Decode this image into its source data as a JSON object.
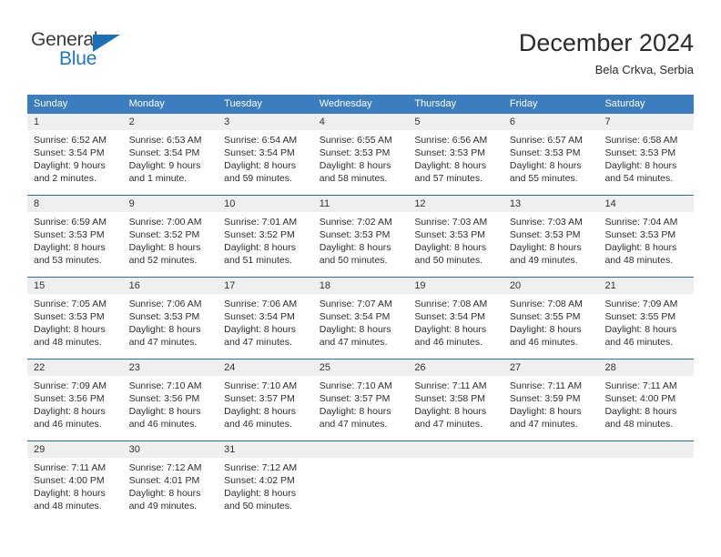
{
  "brand": {
    "name_part1": "General",
    "name_part2": "Blue",
    "triangle_icon": "triangle-icon",
    "accent_color": "#1b6fb5"
  },
  "header": {
    "title": "December 2024",
    "subtitle": "Bela Crkva, Serbia"
  },
  "calendar": {
    "header_bg": "#3b7dbf",
    "daynum_bg": "#efefef",
    "row_border": "#2e6da4",
    "weekdays": [
      "Sunday",
      "Monday",
      "Tuesday",
      "Wednesday",
      "Thursday",
      "Friday",
      "Saturday"
    ],
    "weeks": [
      [
        {
          "day": "1",
          "lines": [
            "Sunrise: 6:52 AM",
            "Sunset: 3:54 PM",
            "Daylight: 9 hours",
            "and 2 minutes."
          ]
        },
        {
          "day": "2",
          "lines": [
            "Sunrise: 6:53 AM",
            "Sunset: 3:54 PM",
            "Daylight: 9 hours",
            "and 1 minute."
          ]
        },
        {
          "day": "3",
          "lines": [
            "Sunrise: 6:54 AM",
            "Sunset: 3:54 PM",
            "Daylight: 8 hours",
            "and 59 minutes."
          ]
        },
        {
          "day": "4",
          "lines": [
            "Sunrise: 6:55 AM",
            "Sunset: 3:53 PM",
            "Daylight: 8 hours",
            "and 58 minutes."
          ]
        },
        {
          "day": "5",
          "lines": [
            "Sunrise: 6:56 AM",
            "Sunset: 3:53 PM",
            "Daylight: 8 hours",
            "and 57 minutes."
          ]
        },
        {
          "day": "6",
          "lines": [
            "Sunrise: 6:57 AM",
            "Sunset: 3:53 PM",
            "Daylight: 8 hours",
            "and 55 minutes."
          ]
        },
        {
          "day": "7",
          "lines": [
            "Sunrise: 6:58 AM",
            "Sunset: 3:53 PM",
            "Daylight: 8 hours",
            "and 54 minutes."
          ]
        }
      ],
      [
        {
          "day": "8",
          "lines": [
            "Sunrise: 6:59 AM",
            "Sunset: 3:53 PM",
            "Daylight: 8 hours",
            "and 53 minutes."
          ]
        },
        {
          "day": "9",
          "lines": [
            "Sunrise: 7:00 AM",
            "Sunset: 3:52 PM",
            "Daylight: 8 hours",
            "and 52 minutes."
          ]
        },
        {
          "day": "10",
          "lines": [
            "Sunrise: 7:01 AM",
            "Sunset: 3:52 PM",
            "Daylight: 8 hours",
            "and 51 minutes."
          ]
        },
        {
          "day": "11",
          "lines": [
            "Sunrise: 7:02 AM",
            "Sunset: 3:53 PM",
            "Daylight: 8 hours",
            "and 50 minutes."
          ]
        },
        {
          "day": "12",
          "lines": [
            "Sunrise: 7:03 AM",
            "Sunset: 3:53 PM",
            "Daylight: 8 hours",
            "and 50 minutes."
          ]
        },
        {
          "day": "13",
          "lines": [
            "Sunrise: 7:03 AM",
            "Sunset: 3:53 PM",
            "Daylight: 8 hours",
            "and 49 minutes."
          ]
        },
        {
          "day": "14",
          "lines": [
            "Sunrise: 7:04 AM",
            "Sunset: 3:53 PM",
            "Daylight: 8 hours",
            "and 48 minutes."
          ]
        }
      ],
      [
        {
          "day": "15",
          "lines": [
            "Sunrise: 7:05 AM",
            "Sunset: 3:53 PM",
            "Daylight: 8 hours",
            "and 48 minutes."
          ]
        },
        {
          "day": "16",
          "lines": [
            "Sunrise: 7:06 AM",
            "Sunset: 3:53 PM",
            "Daylight: 8 hours",
            "and 47 minutes."
          ]
        },
        {
          "day": "17",
          "lines": [
            "Sunrise: 7:06 AM",
            "Sunset: 3:54 PM",
            "Daylight: 8 hours",
            "and 47 minutes."
          ]
        },
        {
          "day": "18",
          "lines": [
            "Sunrise: 7:07 AM",
            "Sunset: 3:54 PM",
            "Daylight: 8 hours",
            "and 47 minutes."
          ]
        },
        {
          "day": "19",
          "lines": [
            "Sunrise: 7:08 AM",
            "Sunset: 3:54 PM",
            "Daylight: 8 hours",
            "and 46 minutes."
          ]
        },
        {
          "day": "20",
          "lines": [
            "Sunrise: 7:08 AM",
            "Sunset: 3:55 PM",
            "Daylight: 8 hours",
            "and 46 minutes."
          ]
        },
        {
          "day": "21",
          "lines": [
            "Sunrise: 7:09 AM",
            "Sunset: 3:55 PM",
            "Daylight: 8 hours",
            "and 46 minutes."
          ]
        }
      ],
      [
        {
          "day": "22",
          "lines": [
            "Sunrise: 7:09 AM",
            "Sunset: 3:56 PM",
            "Daylight: 8 hours",
            "and 46 minutes."
          ]
        },
        {
          "day": "23",
          "lines": [
            "Sunrise: 7:10 AM",
            "Sunset: 3:56 PM",
            "Daylight: 8 hours",
            "and 46 minutes."
          ]
        },
        {
          "day": "24",
          "lines": [
            "Sunrise: 7:10 AM",
            "Sunset: 3:57 PM",
            "Daylight: 8 hours",
            "and 46 minutes."
          ]
        },
        {
          "day": "25",
          "lines": [
            "Sunrise: 7:10 AM",
            "Sunset: 3:57 PM",
            "Daylight: 8 hours",
            "and 47 minutes."
          ]
        },
        {
          "day": "26",
          "lines": [
            "Sunrise: 7:11 AM",
            "Sunset: 3:58 PM",
            "Daylight: 8 hours",
            "and 47 minutes."
          ]
        },
        {
          "day": "27",
          "lines": [
            "Sunrise: 7:11 AM",
            "Sunset: 3:59 PM",
            "Daylight: 8 hours",
            "and 47 minutes."
          ]
        },
        {
          "day": "28",
          "lines": [
            "Sunrise: 7:11 AM",
            "Sunset: 4:00 PM",
            "Daylight: 8 hours",
            "and 48 minutes."
          ]
        }
      ],
      [
        {
          "day": "29",
          "lines": [
            "Sunrise: 7:11 AM",
            "Sunset: 4:00 PM",
            "Daylight: 8 hours",
            "and 48 minutes."
          ]
        },
        {
          "day": "30",
          "lines": [
            "Sunrise: 7:12 AM",
            "Sunset: 4:01 PM",
            "Daylight: 8 hours",
            "and 49 minutes."
          ]
        },
        {
          "day": "31",
          "lines": [
            "Sunrise: 7:12 AM",
            "Sunset: 4:02 PM",
            "Daylight: 8 hours",
            "and 50 minutes."
          ]
        },
        {
          "day": "",
          "lines": []
        },
        {
          "day": "",
          "lines": []
        },
        {
          "day": "",
          "lines": []
        },
        {
          "day": "",
          "lines": []
        }
      ]
    ]
  }
}
